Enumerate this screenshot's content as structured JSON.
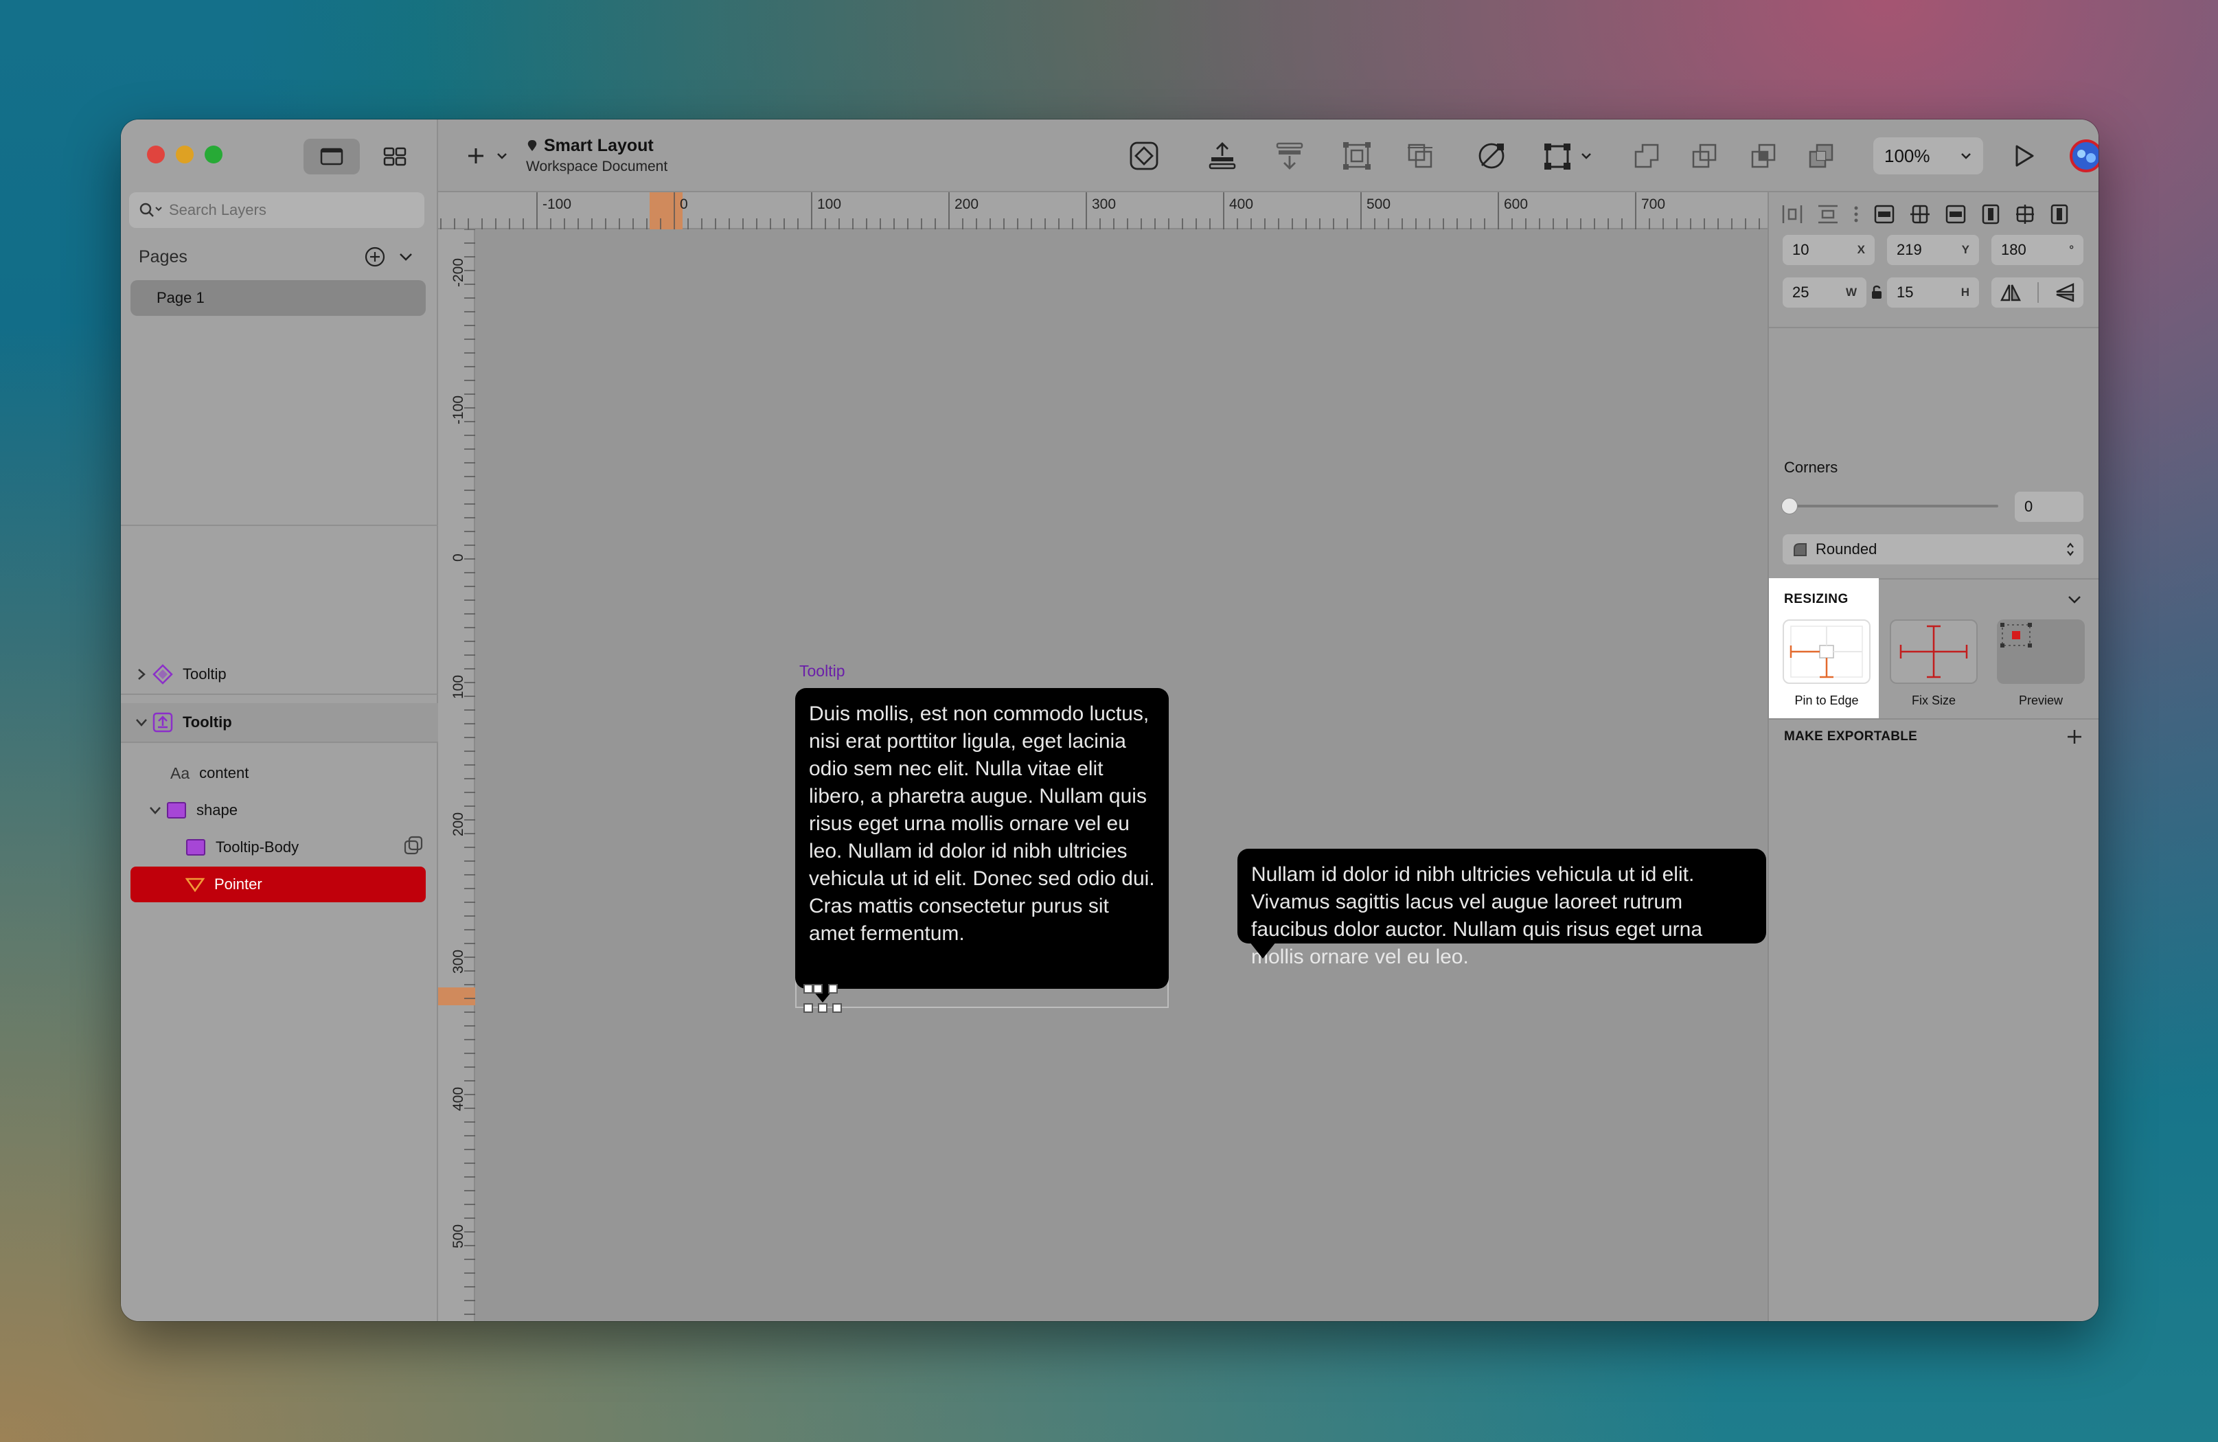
{
  "window": {
    "doc_title": "Smart Layout",
    "doc_subtitle": "Workspace Document"
  },
  "sidebar": {
    "search_placeholder": "Search Layers",
    "pages_label": "Pages",
    "pages": [
      {
        "label": "Page 1"
      }
    ],
    "layers": [
      {
        "label": "Tooltip",
        "icon": "symbol-diamond-icon"
      },
      {
        "label": "Tooltip",
        "icon": "symbol-master-icon"
      },
      {
        "label": "content",
        "icon": "text-layer-icon"
      },
      {
        "label": "shape",
        "icon": "group-shape-icon"
      },
      {
        "label": "Tooltip-Body",
        "icon": "rectangle-icon"
      },
      {
        "label": "Pointer",
        "icon": "triangle-icon"
      }
    ]
  },
  "toolbar": {
    "zoom": "100%"
  },
  "rulers": {
    "top_labels": [
      "-100",
      "0",
      "100",
      "200",
      "300",
      "400",
      "500",
      "600",
      "700"
    ],
    "left_labels": [
      "-200",
      "-100",
      "0",
      "100",
      "200",
      "300",
      "400",
      "500"
    ]
  },
  "canvas": {
    "artboard_label": "Tooltip",
    "tooltip1_text": "Duis mollis, est non commodo luctus, nisi erat porttitor ligula, eget lacinia odio sem nec elit. Nulla vitae elit libero, a pharetra augue. Nullam quis risus eget urna mollis ornare vel eu leo. Nullam id dolor id nibh ultricies vehicula ut id elit. Donec sed odio dui. Cras mattis consectetur purus sit amet fermentum.",
    "tooltip2_text": "Nullam id dolor id nibh ultricies vehicula ut id elit. Vivamus sagittis lacus vel augue laoreet rutrum faucibus dolor auctor. Nullam quis risus eget urna mollis ornare vel eu leo."
  },
  "inspector": {
    "x": "10",
    "x_label": "X",
    "y": "219",
    "y_label": "Y",
    "rotation": "180",
    "rotation_label": "°",
    "w": "25",
    "w_label": "W",
    "h": "15",
    "h_label": "H",
    "corners_label": "Corners",
    "corner_value": "0",
    "corner_style": "Rounded",
    "resizing_label": "RESIZING",
    "resizing_options": [
      "Pin to Edge",
      "Fix Size",
      "Preview"
    ],
    "make_exportable_label": "MAKE EXPORTABLE"
  },
  "colors": {
    "selection_red": "#c0000b",
    "artboard_label": "#6a1fa8",
    "ruler_highlight": "#d08a5c"
  }
}
